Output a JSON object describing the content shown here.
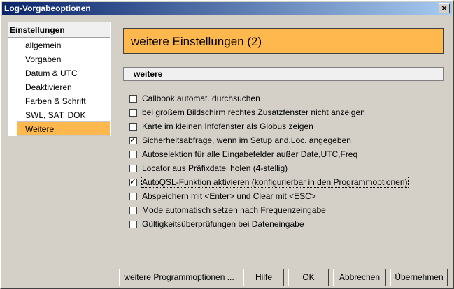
{
  "window": {
    "title": "Log-Vorgabeoptionen",
    "close_glyph": "×"
  },
  "sidebar": {
    "heading": "Einstellungen",
    "items": [
      {
        "label": "allgemein"
      },
      {
        "label": "Vorgaben"
      },
      {
        "label": "Datum & UTC"
      },
      {
        "label": "Deaktivieren"
      },
      {
        "label": "Farben & Schrift"
      },
      {
        "label": "SWL, SAT, DOK"
      },
      {
        "label": "Weitere"
      }
    ],
    "selected": "Weitere"
  },
  "main": {
    "title": "weitere Einstellungen (2)",
    "section": "weitere",
    "options": [
      {
        "label": "Callbook automat. durchsuchen",
        "checked": false
      },
      {
        "label": "bei großem Bildschirm rechtes Zusatzfenster nicht anzeigen",
        "checked": false
      },
      {
        "label": "Karte im kleinen Infofenster als Globus zeigen",
        "checked": false
      },
      {
        "label": "Sicherheitsabfrage, wenn im Setup and.Loc. angegeben",
        "checked": true
      },
      {
        "label": "Autoselektion für alle Eingabefelder außer Date,UTC,Freq",
        "checked": false
      },
      {
        "label": "Locator aus Präfixdatei holen (4-stellig)",
        "checked": false
      },
      {
        "label": "AutoQSL-Funktion aktivieren (konfigurierbar in den Programmoptionen)",
        "checked": true
      },
      {
        "label": "Abspeichern mit <Enter> und Clear mit <ESC>",
        "checked": false
      },
      {
        "label": "Mode automatisch setzen nach Frequenzeingabe",
        "checked": false
      },
      {
        "label": "Gültigkeitsüberprüfungen bei Dateneingabe",
        "checked": false
      }
    ],
    "check_glyph": "✓"
  },
  "buttons": {
    "more_options": "weitere Programmoptionen ...",
    "help": "Hilfe",
    "ok": "OK",
    "cancel": "Abbrechen",
    "apply": "Übernehmen"
  },
  "colors": {
    "accent": "#ffb84d",
    "face": "#d4d0c8",
    "title_start": "#0a246a",
    "title_end": "#a6caf0"
  }
}
